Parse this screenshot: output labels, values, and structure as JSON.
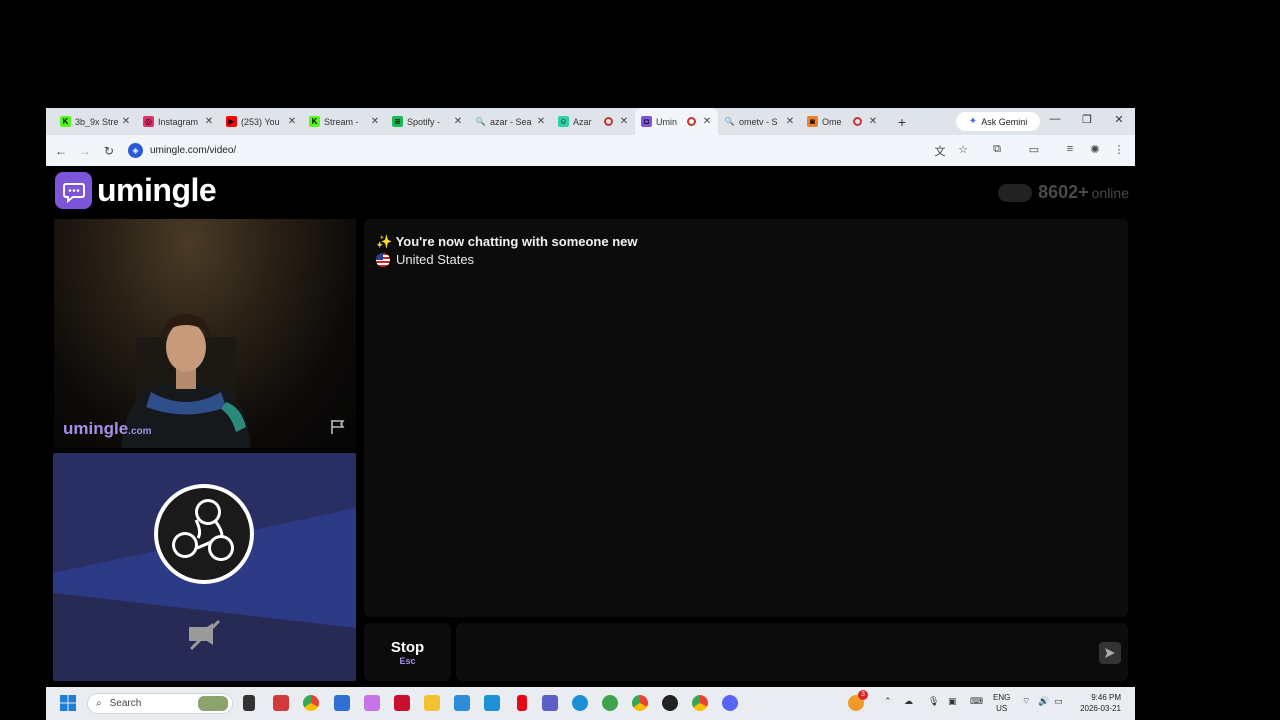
{
  "browser": {
    "tabs": [
      {
        "title": "3b_9x Stre",
        "favicon_color": "#53fc18",
        "favicon_glyph": "K"
      },
      {
        "title": "Instagram",
        "favicon_color": "#e1306c",
        "favicon_glyph": "◎"
      },
      {
        "title": "(253) You",
        "favicon_color": "#ff0000",
        "favicon_glyph": "▶"
      },
      {
        "title": "Stream - ",
        "favicon_color": "#53fc18",
        "favicon_glyph": "K"
      },
      {
        "title": "Spotify - ",
        "favicon_color": "#1db954",
        "favicon_glyph": "≋"
      },
      {
        "title": "azar - Sea",
        "favicon_color": "transparent",
        "favicon_glyph": "🔍"
      },
      {
        "title": "Azar",
        "favicon_color": "#2ed1a2",
        "favicon_glyph": "☺"
      },
      {
        "title": "Umin",
        "favicon_color": "#7d55d8",
        "favicon_glyph": "◘"
      },
      {
        "title": "ometv - S",
        "favicon_color": "transparent",
        "favicon_glyph": "🔍"
      },
      {
        "title": "Ome",
        "favicon_color": "#f07f2a",
        "favicon_glyph": "◙"
      }
    ],
    "new_tab": "+",
    "ask_gemini": "Ask Gemini",
    "url": "umingle.com/video/"
  },
  "page": {
    "logo_text": "umingle",
    "online_count": "8602+",
    "online_label": "online",
    "watermark": "umingle",
    "watermark_suffix": ".com",
    "chat": {
      "message_emoji": "✨",
      "message": "You're now chatting with someone new",
      "country": "United States"
    },
    "stop_label": "Stop",
    "stop_key": "Esc",
    "colors": {
      "brand": "#7d55d8",
      "watermark": "#a78ee6",
      "obs_bg": "#2a2f63"
    }
  },
  "taskbar": {
    "search_placeholder": "Search",
    "lang_line1": "ENG",
    "lang_line2": "US",
    "time": "9:46 PM",
    "date": "2026-03-21",
    "notification_badge": "3"
  }
}
